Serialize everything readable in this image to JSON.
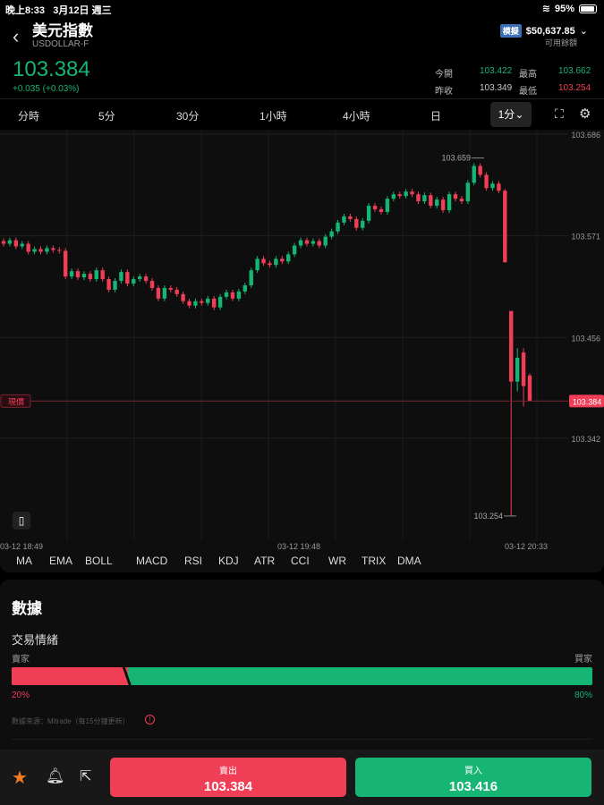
{
  "status_bar": {
    "time": "晚上8:33",
    "date": "3月12日 週三",
    "battery": "95%"
  },
  "header": {
    "title": "美元指數",
    "symbol": "USDOLLAR-F",
    "account_badge": "模擬",
    "balance": "$50,637.85",
    "balance_label": "可用餘額"
  },
  "quote": {
    "price": "103.384",
    "change": "+0.035 (+0.03%)",
    "stats": [
      {
        "label": "今開",
        "value": "103.422"
      },
      {
        "label": "最高",
        "value": "103.662"
      },
      {
        "label": "昨收",
        "value": "103.349"
      },
      {
        "label": "最低",
        "value": "103.254"
      }
    ]
  },
  "timeframes": [
    "分時",
    "5分",
    "30分",
    "1小時",
    "4小時",
    "日"
  ],
  "selected_timeframe": "1分",
  "indicators": [
    "MA",
    "EMA",
    "BOLL",
    "MACD",
    "RSI",
    "KDJ",
    "ATR",
    "CCI",
    "WR",
    "TRIX",
    "DMA"
  ],
  "chart_data": {
    "type": "candlestick",
    "y_ticks": [
      "103.686",
      "103.571",
      "103.456",
      "103.342"
    ],
    "ylim": [
      103.2205,
      103.686
    ],
    "x_labels": [
      "03-12 18:49",
      "03-12 19:48",
      "03-12 20:33"
    ],
    "current_label": "現價",
    "current_price": 103.384,
    "high_annotation": "103.659",
    "low_annotation": "103.254",
    "first_open": 103.565,
    "closes": [
      103.562,
      103.566,
      103.559,
      103.562,
      103.553,
      103.556,
      103.553,
      103.557,
      103.555,
      103.554,
      103.525,
      103.531,
      103.524,
      103.528,
      103.522,
      103.532,
      103.522,
      103.51,
      103.52,
      103.53,
      103.517,
      103.522,
      103.525,
      103.52,
      103.512,
      103.5,
      103.512,
      103.51,
      103.505,
      103.497,
      103.492,
      103.497,
      103.495,
      103.5,
      103.49,
      103.502,
      103.507,
      103.5,
      103.508,
      103.515,
      103.532,
      103.545,
      103.54,
      103.538,
      103.545,
      103.542,
      103.55,
      103.56,
      103.566,
      103.562,
      103.565,
      103.56,
      103.57,
      103.576,
      103.586,
      103.593,
      103.59,
      103.58,
      103.588,
      103.605,
      103.601,
      103.598,
      103.613,
      103.618,
      103.616,
      103.621,
      103.618,
      103.61,
      103.617,
      103.605,
      103.612,
      103.6,
      103.618,
      103.613,
      103.61,
      103.631,
      103.65,
      103.64,
      103.625,
      103.63,
      103.622
    ],
    "last_candles": [
      {
        "o": 103.622,
        "h": 103.624,
        "l": 103.541,
        "c": 103.541
      },
      {
        "o": 103.486,
        "h": 103.486,
        "l": 103.254,
        "c": 103.406
      },
      {
        "o": 103.406,
        "h": 103.444,
        "l": 103.395,
        "c": 103.433
      },
      {
        "o": 103.439,
        "h": 103.444,
        "l": 103.378,
        "c": 103.401
      },
      {
        "o": 103.413,
        "h": 103.415,
        "l": 103.387,
        "c": 103.384
      }
    ]
  },
  "sentiment": {
    "section_title": "數據",
    "title": "交易情緒",
    "seller_label": "賣家",
    "buyer_label": "買家",
    "seller_pct": "20%",
    "buyer_pct": "80%",
    "seller_fraction": 0.2,
    "source": "數據來源：Mitrade（每15分鐘更新）"
  },
  "actions": {
    "sell_label": "賣出",
    "sell_price": "103.384",
    "buy_label": "買入",
    "buy_price": "103.416"
  },
  "colors": {
    "up": "#16b574",
    "down": "#ef3e55",
    "star": "#f47b20",
    "badge": "#3b6fb6"
  }
}
